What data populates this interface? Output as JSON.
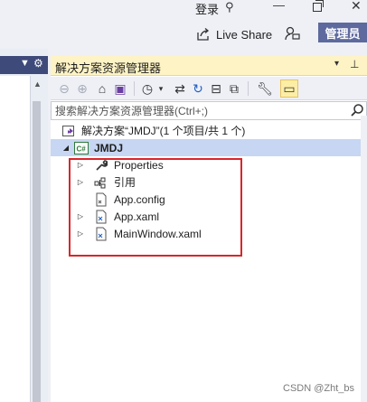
{
  "titlebar": {
    "login": "登录",
    "live_share": "Live Share",
    "admin": "管理员"
  },
  "solution_explorer": {
    "title": "解决方案资源管理器",
    "search_placeholder": "搜索解决方案资源管理器(Ctrl+;)",
    "solution_label": "解决方案“JMDJ”(1 个项目/共 1 个)",
    "project_label": "JMDJ",
    "project_badge": "C#",
    "items": [
      {
        "label": "Properties",
        "icon": "wrench-icon",
        "expandable": true
      },
      {
        "label": "引用",
        "icon": "references-icon",
        "expandable": true
      },
      {
        "label": "App.config",
        "icon": "config-file-icon",
        "expandable": false
      },
      {
        "label": "App.xaml",
        "icon": "xaml-file-icon",
        "expandable": true
      },
      {
        "label": "MainWindow.xaml",
        "icon": "xaml-file-icon",
        "expandable": true
      }
    ]
  },
  "watermark": "CSDN @Zht_bs",
  "colors": {
    "accent": "#5e6a9e",
    "title_yellow": "#fdf3c5",
    "selection": "#c7d6f2",
    "highlight_box": "#d9262a"
  }
}
